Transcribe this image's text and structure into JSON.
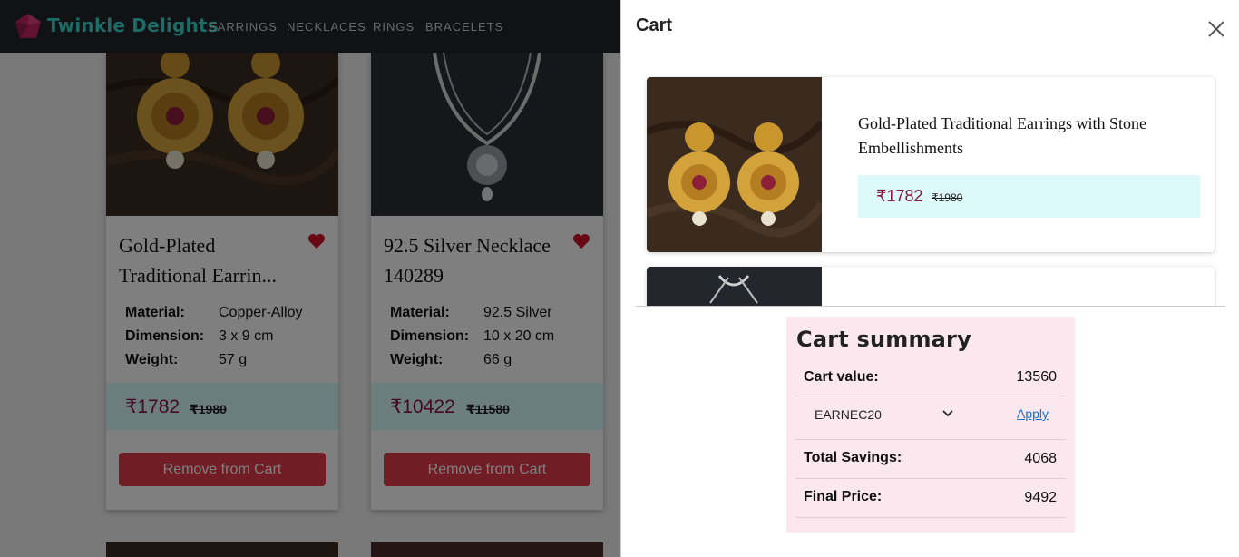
{
  "header": {
    "brand": "Twinkle Delights",
    "nav": [
      "EARRINGS",
      "NECKLACES",
      "RINGS",
      "BRACELETS"
    ]
  },
  "products": [
    {
      "title": "Gold-Plated Traditional Earrin...",
      "specs": [
        {
          "label": "Material:",
          "value": "Copper-Alloy"
        },
        {
          "label": "Dimension:",
          "value": "3 x 9  cm"
        },
        {
          "label": "Weight:",
          "value": "57  g"
        }
      ],
      "price": "₹1782",
      "mrp": "₹1980",
      "button": "Remove from Cart"
    },
    {
      "title": "92.5 Silver Necklace 140289",
      "specs": [
        {
          "label": "Material:",
          "value": "92.5 Silver"
        },
        {
          "label": "Dimension:",
          "value": "10 x 20  cm"
        },
        {
          "label": "Weight:",
          "value": "66  g"
        }
      ],
      "price": "₹10422",
      "mrp": "₹11580",
      "button": "Remove from Cart"
    }
  ],
  "cart": {
    "title": "Cart",
    "items": [
      {
        "name": "Gold-Plated Traditional Earrings with Stone Embellishments",
        "price": "₹1782",
        "mrp": "₹1980"
      }
    ],
    "summary": {
      "heading": "Cart summary",
      "cart_value_label": "Cart value:",
      "cart_value": "13560",
      "coupon": "EARNEC20",
      "apply_label": "Apply",
      "savings_label": "Total Savings:",
      "savings": "4068",
      "final_label": "Final Price:",
      "final": "9492"
    }
  },
  "colors": {
    "accent_price": "#8a1541",
    "remove_button": "#e03a4d",
    "price_band": "#d8fbfb",
    "summary_bg": "#fbe8ef",
    "brand": "#39d6cf"
  },
  "icons": [
    "logo-icon",
    "heart-icon",
    "close-icon",
    "chevron-down-icon"
  ]
}
